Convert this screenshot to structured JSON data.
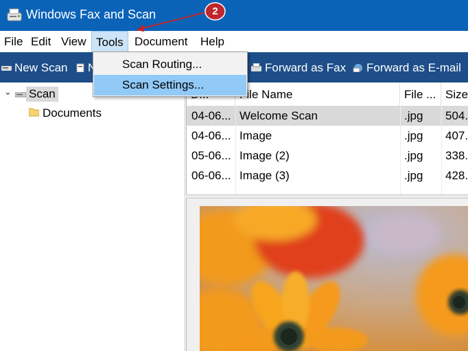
{
  "window": {
    "title": "Windows Fax and Scan",
    "icon": "fax-scan-app-icon"
  },
  "menubar": {
    "items": [
      "File",
      "Edit",
      "View",
      "Tools",
      "Document",
      "Help"
    ],
    "active": "Tools"
  },
  "toolbar": {
    "new_scan": "New Scan",
    "partial": "N",
    "forward_fax": "Forward as Fax",
    "forward_email": "Forward as E-mail"
  },
  "tools_menu": {
    "items": [
      "Scan Routing...",
      "Scan Settings..."
    ],
    "highlighted": "Scan Settings..."
  },
  "tree": {
    "root": "Scan",
    "child": "Documents",
    "expanded": true
  },
  "file_list": {
    "columns": [
      "D...",
      "File Name",
      "File ...",
      "Size"
    ],
    "rows": [
      {
        "date": "04-06...",
        "name": "Welcome Scan",
        "type": ".jpg",
        "size": "504."
      },
      {
        "date": "04-06...",
        "name": "Image",
        "type": ".jpg",
        "size": "407."
      },
      {
        "date": "05-06...",
        "name": "Image (2)",
        "type": ".jpg",
        "size": "338."
      },
      {
        "date": "06-06...",
        "name": "Image (3)",
        "type": ".jpg",
        "size": "428."
      }
    ],
    "selected_row": 0
  },
  "annotation": {
    "step": "2",
    "color": "#c0262d"
  },
  "colors": {
    "titlebar": "#0b63b8",
    "toolbar": "#1d4e89",
    "menu_hover": "#91c9f7",
    "selection": "#d9d9d9"
  },
  "preview": {
    "subject": "orange daisy flowers image"
  }
}
